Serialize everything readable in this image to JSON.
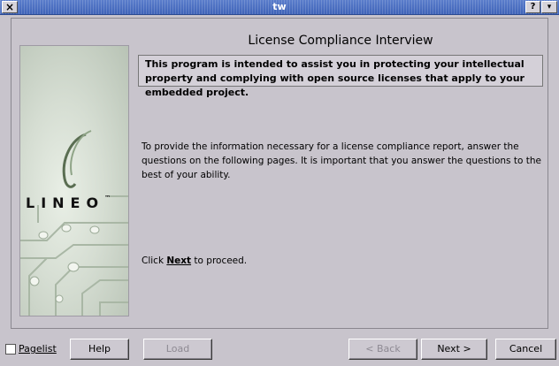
{
  "window": {
    "title": "tw",
    "close_glyph": "×",
    "help_glyph": "?",
    "menu_glyph": "▾"
  },
  "header": {
    "title": "License Compliance Interview"
  },
  "intro": {
    "text": "This program is intended to assist you in protecting your intellectual property and complying with open source licenses that apply to your embedded project."
  },
  "body": {
    "paragraph": "To provide the information necessary for a license compliance report, answer the questions on the following pages. It is important that you answer the questions to the best of your ability.",
    "proceed_prefix": "Click ",
    "proceed_bold": "Next",
    "proceed_suffix": " to proceed."
  },
  "sidebar": {
    "logo_text": "LINEO",
    "logo_tm": "™"
  },
  "footer": {
    "pagelist_label": "Pagelist",
    "pagelist_checked": false,
    "buttons": {
      "help": "Help",
      "load": "Load",
      "back": "< Back",
      "next": "Next >",
      "cancel": "Cancel"
    }
  }
}
